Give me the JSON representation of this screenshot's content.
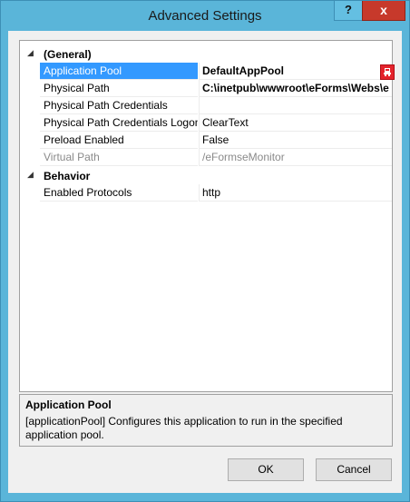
{
  "window": {
    "title": "Advanced Settings",
    "help_label": "?",
    "close_label": "x"
  },
  "grid": {
    "general": {
      "toggle": "◢",
      "label": "(General)",
      "props": [
        {
          "name": "Application Pool",
          "value": "DefaultAppPool"
        },
        {
          "name": "Physical Path",
          "value": "C:\\inetpub\\wwwroot\\eForms\\Webs\\e"
        },
        {
          "name": "Physical Path Credentials",
          "value": ""
        },
        {
          "name": "Physical Path Credentials Logon",
          "value": "ClearText"
        },
        {
          "name": "Preload Enabled",
          "value": "False"
        },
        {
          "name": "Virtual Path",
          "value": "/eFormseMonitor"
        }
      ]
    },
    "behavior": {
      "toggle": "◢",
      "label": "Behavior",
      "props": [
        {
          "name": "Enabled Protocols",
          "value": "http"
        }
      ]
    },
    "selected_icon": "error-icon",
    "selection_color": "#3399ff"
  },
  "description": {
    "title": "Application Pool",
    "text": "[applicationPool] Configures this application to run in the specified application pool."
  },
  "buttons": {
    "ok": "OK",
    "cancel": "Cancel"
  }
}
